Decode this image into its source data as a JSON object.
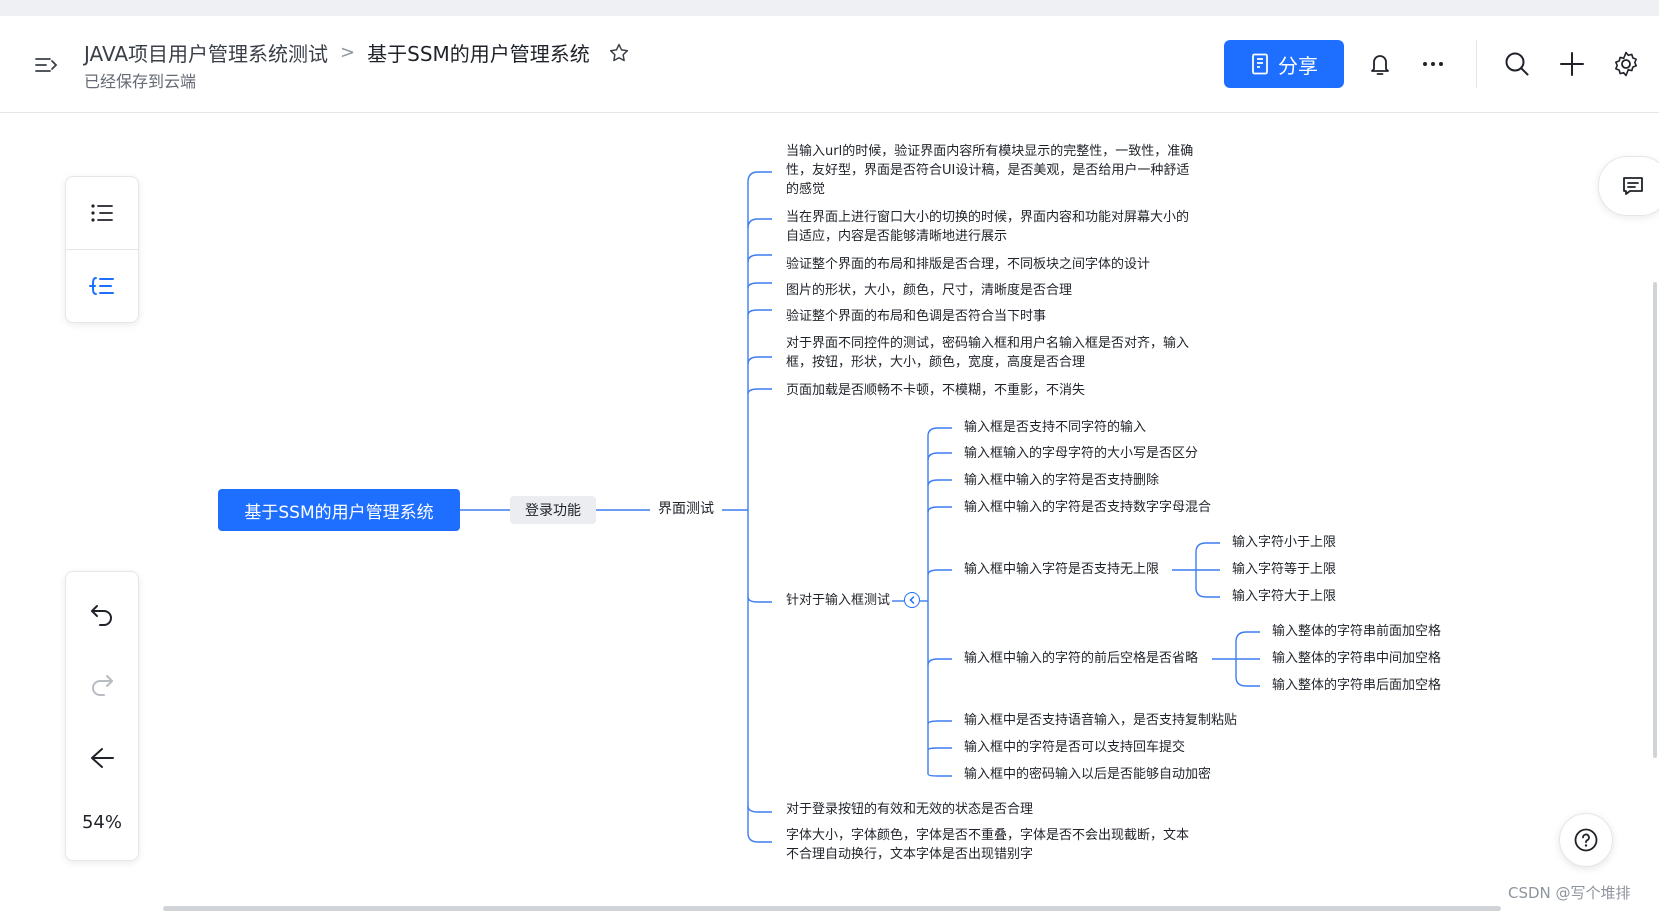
{
  "header": {
    "breadcrumb_parent": "JAVA项目用户管理系统测试",
    "breadcrumb_separator": ">",
    "title": "基于SSM的用户管理系统",
    "saved_status": "已经保存到云端",
    "share_label": "分享"
  },
  "icons": [
    "menu-toggle-icon",
    "star-icon",
    "share-doc-icon",
    "bell-icon",
    "more-icon",
    "search-icon",
    "plus-icon",
    "gear-icon",
    "outline-icon",
    "mindmap-structure-icon",
    "undo-icon",
    "redo-icon",
    "layout-left-icon",
    "comment-icon",
    "help-icon"
  ],
  "colors": {
    "accent": "#1e6fff",
    "line": "#3d7cf2",
    "pill_bg": "#ebedf0"
  },
  "left_panel": {
    "zoom": "54%"
  },
  "watermark": "CSDN @写个堆排",
  "mindmap": {
    "root": "基于SSM的用户管理系统",
    "level1": "登录功能",
    "level2": "界面测试",
    "items": [
      "当输入url的时候，验证界面内容所有模块显示的完整性，一致性，准确性，友好型，界面是否符合UI设计稿，是否美观，是否给用户一种舒适的感觉",
      "当在界面上进行窗口大小的切换的时候，界面内容和功能对屏幕大小的自适应，内容是否能够清晰地进行展示",
      "验证整个界面的布局和排版是否合理，不同板块之间字体的设计",
      "图片的形状，大小，颜色，尺寸，清晰度是否合理",
      "验证整个界面的布局和色调是否符合当下时事",
      "对于界面不同控件的测试，密码输入框和用户名输入框是否对齐，输入框，按钮，形状，大小，颜色，宽度，高度是否合理",
      "页面加载是否顺畅不卡顿，不模糊，不重影，不消失",
      "针对于输入框测试",
      "对于登录按钮的有效和无效的状态是否合理",
      "字体大小，字体颜色，字体是否不重叠，字体是否不会出现截断，文本不合理自动换行，文本字体是否出现错别字"
    ],
    "input_tests": [
      "输入框是否支持不同字符的输入",
      "输入框输入的字母字符的大小写是否区分",
      "输入框中输入的字符是否支持删除",
      "输入框中输入的字符是否支持数字字母混合",
      "输入框中输入字符是否支持无上限",
      "输入框中输入的字符的前后空格是否省略",
      "输入框中是否支持语音输入，是否支持复制粘贴",
      "输入框中的字符是否可以支持回车提交",
      "输入框中的密码输入以后是否能够自动加密"
    ],
    "limit_tests": [
      "输入字符小于上限",
      "输入字符等于上限",
      "输入字符大于上限"
    ],
    "space_tests": [
      "输入整体的字符串前面加空格",
      "输入整体的字符串中间加空格",
      "输入整体的字符串后面加空格"
    ]
  }
}
